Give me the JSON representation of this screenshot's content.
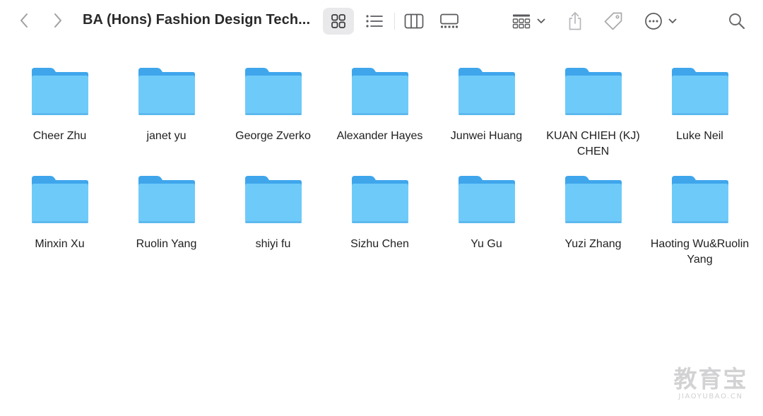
{
  "window": {
    "title": "BA (Hons) Fashion Design Tech..."
  },
  "toolbar": {
    "icons": {
      "back": "chevron-left-icon",
      "forward": "chevron-right-icon",
      "view_icons": "grid-view-icon",
      "view_list": "list-view-icon",
      "view_columns": "column-view-icon",
      "view_gallery": "gallery-view-icon",
      "group": "group-by-icon",
      "share": "share-icon",
      "tag": "tag-icon",
      "more": "ellipsis-circle-icon",
      "search": "search-icon"
    },
    "active_view": "icons"
  },
  "folders": [
    "Cheer Zhu",
    "janet yu",
    "George Zverko",
    "Alexander Hayes",
    "Junwei Huang",
    "KUAN CHIEH (KJ) CHEN",
    "Luke Neil",
    "Minxin Xu",
    "Ruolin Yang",
    "shiyi fu",
    "Sizhu Chen",
    "Yu Gu",
    "Yuzi Zhang",
    "Haoting Wu&Ruolin Yang"
  ],
  "colors": {
    "folder_body": "#6ecbf9",
    "folder_tab": "#3fa6ec",
    "active_view_bg": "#e9e9eb"
  },
  "watermark": {
    "main": "教育宝",
    "sub": "JIAOYUBAO.CN"
  }
}
